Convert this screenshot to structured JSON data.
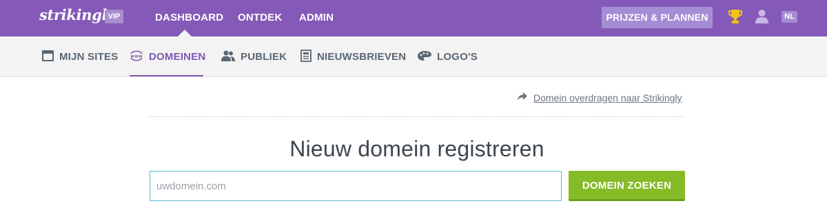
{
  "colors": {
    "brand_purple": "#8559b8",
    "active_purple": "#7b59b5",
    "button_green": "#85bb26",
    "input_border": "#58b6d3",
    "trophy_gold": "#f2c412"
  },
  "header": {
    "logo": "strikingly",
    "badge": "VIP",
    "nav": [
      {
        "label": "DASHBOARD",
        "active": true
      },
      {
        "label": "ONTDEK"
      },
      {
        "label": "ADMIN"
      }
    ],
    "pricing_button": "PRIJZEN & PLANNEN",
    "trophy_icon": "trophy-icon",
    "user_icon": "user-icon",
    "language": "NL"
  },
  "subnav": {
    "items": [
      {
        "label": "MIJN SITES",
        "icon": "browser-window-icon"
      },
      {
        "label": "DOMEINEN",
        "icon": "www-icon",
        "active": true
      },
      {
        "label": "PUBLIEK",
        "icon": "people-icon"
      },
      {
        "label": "NIEUWSBRIEVEN",
        "icon": "newsletter-icon"
      },
      {
        "label": "LOGO'S",
        "icon": "palette-icon"
      }
    ]
  },
  "main": {
    "transfer_link": "Domein overdragen naar Strikingly",
    "title": "Nieuw domein registreren",
    "search": {
      "placeholder": "uwdomein.com",
      "value": "",
      "button": "DOMEIN ZOEKEN"
    }
  }
}
